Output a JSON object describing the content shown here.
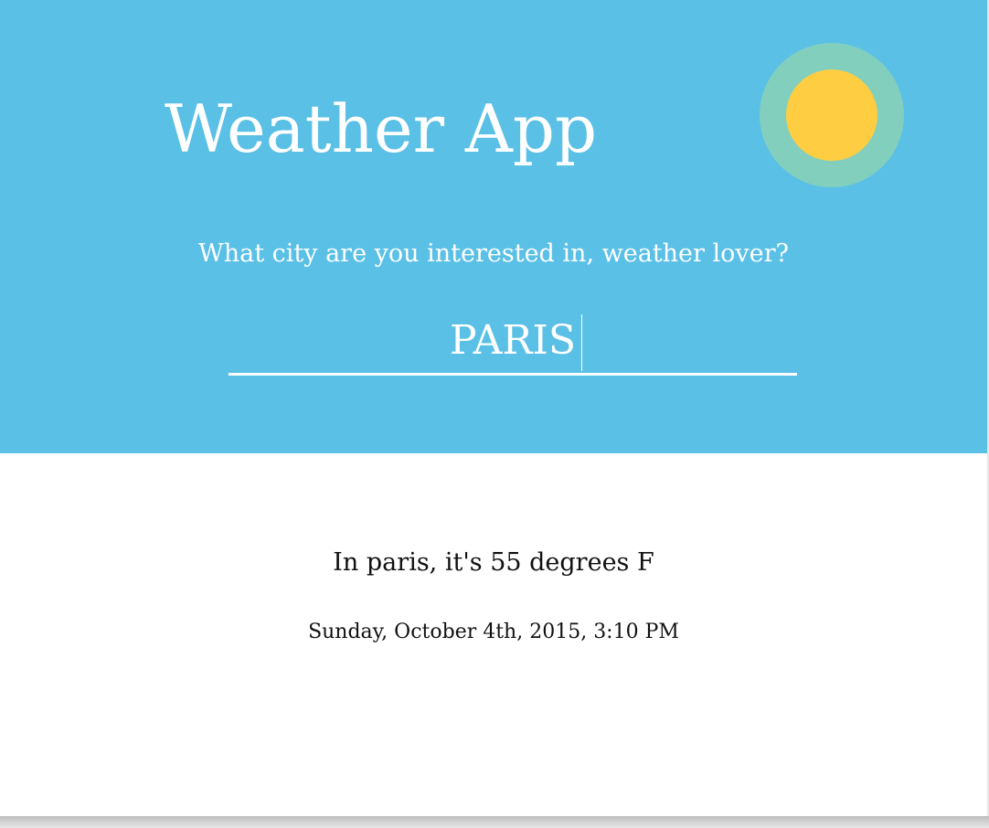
{
  "header": {
    "title": "Weather App",
    "prompt": "What city are you interested in, weather lover?"
  },
  "search": {
    "value": "PARIS"
  },
  "result": {
    "summary": "In paris, it's 55 degrees F",
    "timestamp": "Sunday, October 4th, 2015, 3:10 PM"
  },
  "icons": {
    "logo": "sun-icon"
  },
  "colors": {
    "header_background": "#5bc0e6",
    "sun_ring": "#82cfbe",
    "sun_core": "#ffcd42",
    "header_text": "#ffffff",
    "body_text": "#111111"
  }
}
